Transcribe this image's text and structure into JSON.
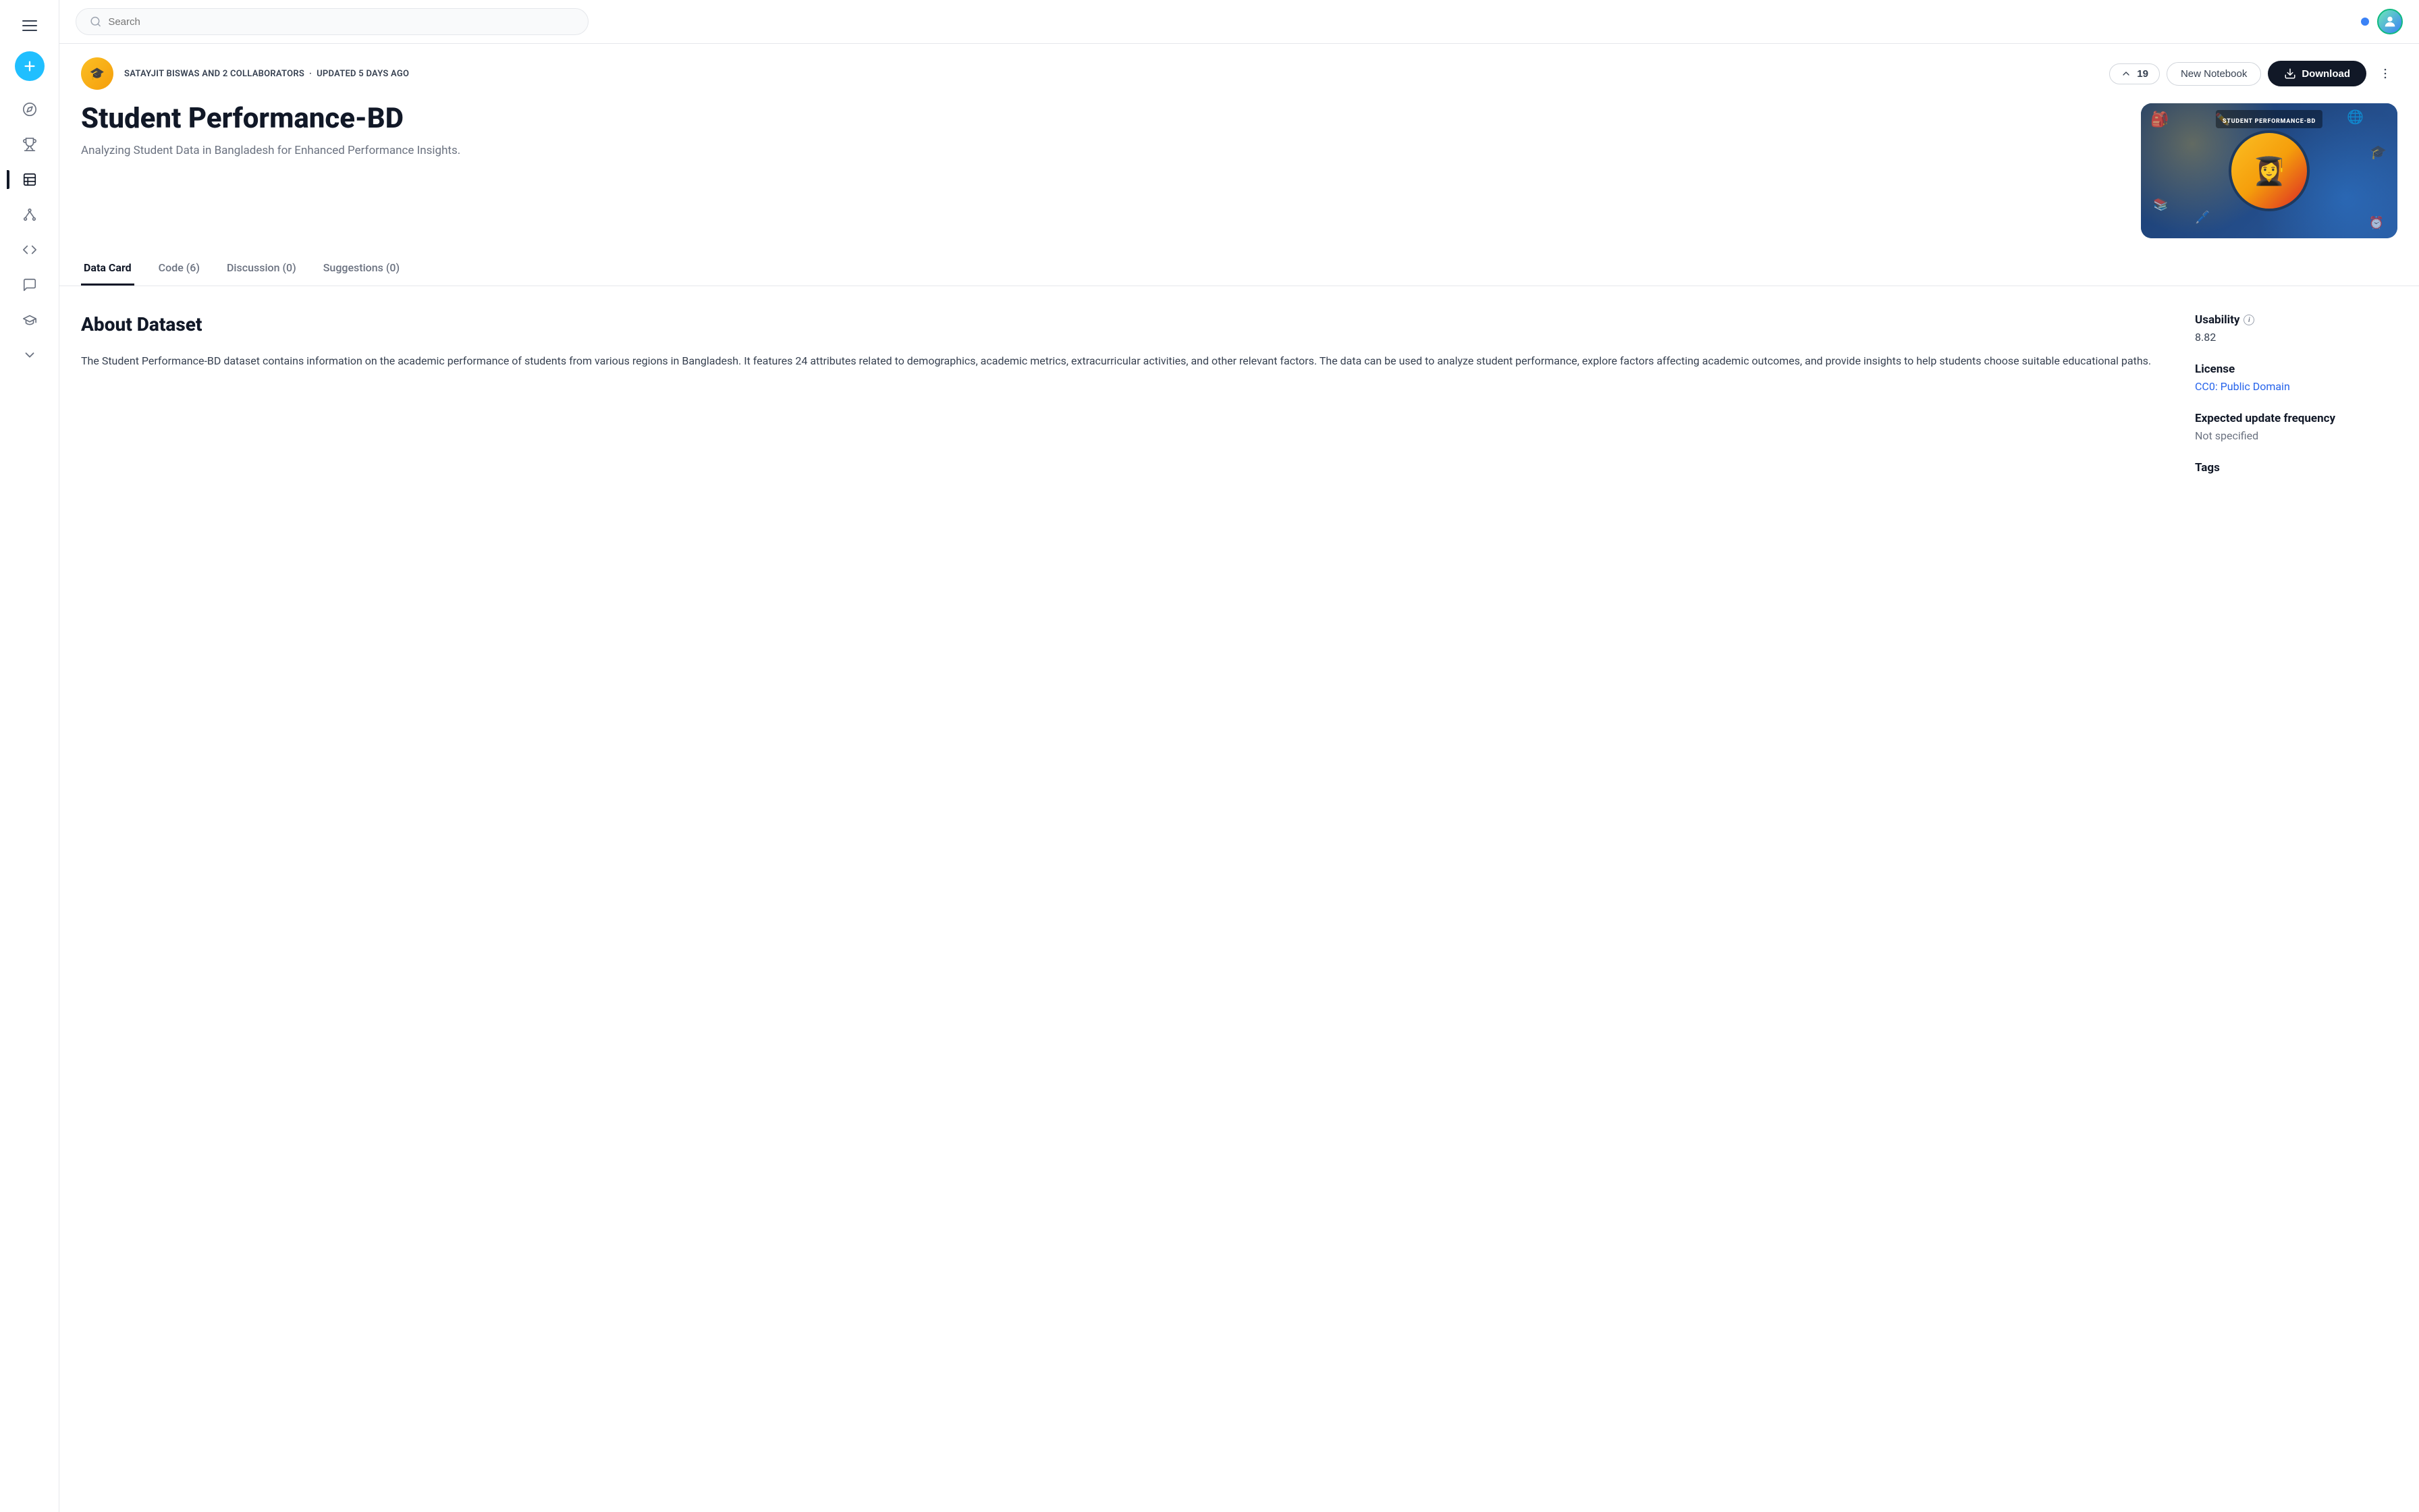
{
  "sidebar": {
    "items": [
      {
        "id": "hamburger",
        "label": "Menu"
      },
      {
        "id": "create",
        "label": "Create"
      },
      {
        "id": "explore",
        "label": "Explore",
        "icon": "compass"
      },
      {
        "id": "competitions",
        "label": "Competitions",
        "icon": "trophy"
      },
      {
        "id": "datasets",
        "label": "Datasets",
        "icon": "table",
        "active": true
      },
      {
        "id": "models",
        "label": "Models",
        "icon": "hierarchy"
      },
      {
        "id": "code",
        "label": "Code",
        "icon": "code"
      },
      {
        "id": "discussions",
        "label": "Discussions",
        "icon": "chat"
      },
      {
        "id": "learn",
        "label": "Learn",
        "icon": "graduation"
      },
      {
        "id": "more",
        "label": "More",
        "icon": "chevron-down"
      }
    ]
  },
  "topbar": {
    "search_placeholder": "Search"
  },
  "dataset": {
    "author": "SATAYJIT BISWAS AND 2 COLLABORATORS",
    "updated": "UPDATED 5 DAYS AGO",
    "vote_count": "19",
    "title": "Student Performance-BD",
    "description": "Analyzing Student Data in Bangladesh for Enhanced Performance Insights.",
    "tabs": [
      {
        "label": "Data Card",
        "active": true
      },
      {
        "label": "Code (6)",
        "active": false
      },
      {
        "label": "Discussion (0)",
        "active": false
      },
      {
        "label": "Suggestions (0)",
        "active": false
      }
    ],
    "about_title": "About Dataset",
    "about_text": "The Student Performance-BD dataset contains information on the academic performance of students from various regions in Bangladesh. It features 24 attributes related to demographics, academic metrics, extracurricular activities, and other relevant factors. The data can be used to analyze student performance, explore factors affecting academic outcomes, and provide insights to help students choose suitable educational paths.",
    "sidebar_info": {
      "usability_label": "Usability",
      "usability_value": "8.82",
      "license_label": "License",
      "license_value": "CC0: Public Domain",
      "update_freq_label": "Expected update frequency",
      "update_freq_value": "Not specified",
      "tags_label": "Tags"
    },
    "buttons": {
      "new_notebook": "New Notebook",
      "download": "Download"
    }
  }
}
